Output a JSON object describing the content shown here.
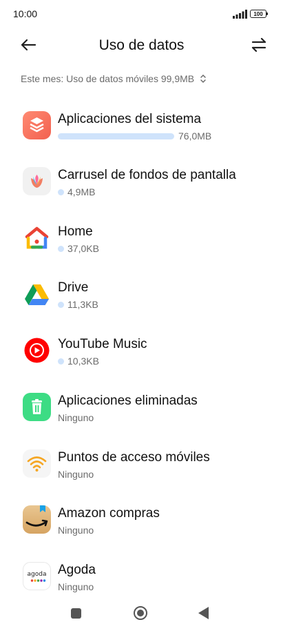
{
  "status": {
    "time": "10:00",
    "battery": "100"
  },
  "header": {
    "title": "Uso de datos"
  },
  "filter": {
    "label": "Este mes: Uso de datos móviles 99,9MB"
  },
  "apps": [
    {
      "name": "Aplicaciones del sistema",
      "usage": "76,0MB",
      "usage_fraction": 0.76
    },
    {
      "name": "Carrusel de fondos de pantalla",
      "usage": "4,9MB"
    },
    {
      "name": "Home",
      "usage": "37,0KB"
    },
    {
      "name": "Drive",
      "usage": "11,3KB"
    },
    {
      "name": "YouTube Music",
      "usage": "10,3KB"
    },
    {
      "name": "Aplicaciones eliminadas",
      "usage": "Ninguno"
    },
    {
      "name": "Puntos de acceso móviles",
      "usage": "Ninguno"
    },
    {
      "name": "Amazon compras",
      "usage": "Ninguno"
    },
    {
      "name": "Agoda",
      "usage": "Ninguno",
      "icon_text": "agoda"
    }
  ],
  "colors": {
    "usage_bar": "#cfe3fb",
    "accent": "#111111"
  }
}
